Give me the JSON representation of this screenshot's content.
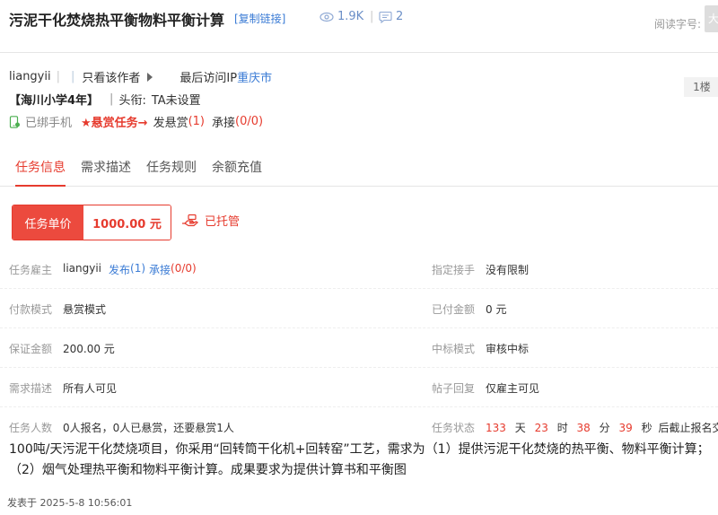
{
  "header": {
    "title": "污泥干化焚烧热平衡物料平衡计算",
    "copy_link": "[复制链接]",
    "views": "1.9K",
    "replies": "2",
    "read_size_label": "阅读字号:",
    "big_font": "大"
  },
  "author": {
    "name": "liangyii",
    "only_author": "只看该作者",
    "last_ip_label": "最后访问IP",
    "last_ip_city": "重庆市",
    "floor": "1楼",
    "school": "【海川小学4年】",
    "title_label": "头衔:",
    "title_value": "TA未设置",
    "phone_bound": "已绑手机",
    "reward_task": "★悬赏任务→",
    "post_reward": "发悬赏",
    "post_reward_count": "(1)",
    "accept": "承接",
    "accept_count": "(0/0)"
  },
  "tabs": [
    "任务信息",
    "需求描述",
    "任务规则",
    "余额充值"
  ],
  "price": {
    "label": "任务单价",
    "value": "1000.00 元",
    "escrow": "已托管"
  },
  "fields": {
    "employer_label": "任务雇主",
    "employer_name": "liangyii",
    "employer_publish": "发布",
    "employer_publish_count": "(1)",
    "employer_accept": "承接",
    "employer_accept_count": "(0/0)",
    "assignee_label": "指定接手",
    "assignee_value": "没有限制",
    "pay_mode_label": "付款模式",
    "pay_mode_value": "悬赏模式",
    "paid_label": "已付金额",
    "paid_value": "0 元",
    "deposit_label": "保证金额",
    "deposit_value": "200.00 元",
    "bid_mode_label": "中标模式",
    "bid_mode_value": "审核中标",
    "desc_vis_label": "需求描述",
    "desc_vis_value": "所有人可见",
    "reply_label": "帖子回复",
    "reply_value": "仅雇主可见",
    "people_label": "任务人数",
    "people_value": "0人报名，0人已悬赏，还要悬赏1人",
    "status_label": "任务状态",
    "days": "133",
    "days_unit": "天",
    "hours": "23",
    "hours_unit": "时",
    "minutes": "38",
    "minutes_unit": "分",
    "seconds": "39",
    "seconds_unit": "秒",
    "deadline_text": "后截止报名交稿"
  },
  "description": "100吨/天污泥干化焚烧项目，你采用“回转筒干化机+回转窑”工艺，需求为（1）提供污泥干化焚烧的热平衡、物料平衡计算；（2）烟气处理热平衡和物料平衡计算。成果要求为提供计算书和平衡图",
  "posted": "发表于 2025-5-8 10:56:01",
  "colors": {
    "accent_red": "#e63b2e",
    "link_blue": "#3a7bd5"
  }
}
